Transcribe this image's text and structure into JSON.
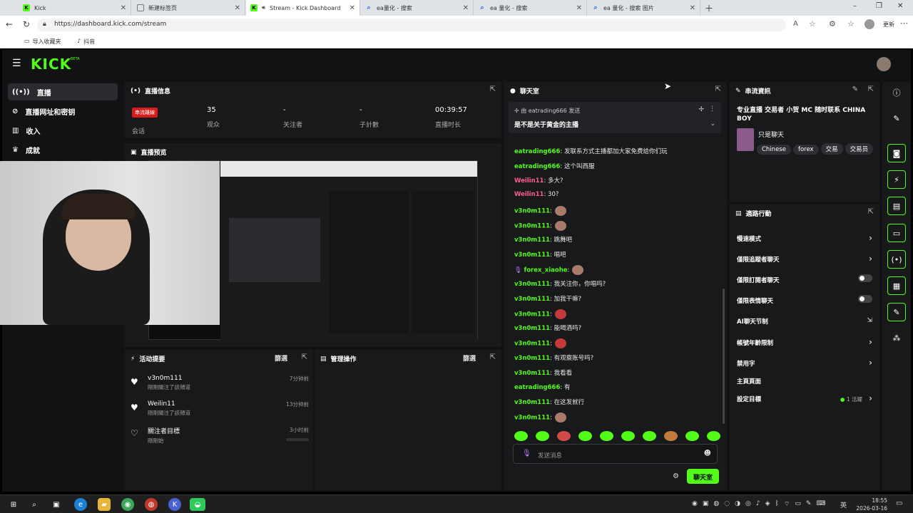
{
  "browser": {
    "tabs": [
      {
        "label": "Kick"
      },
      {
        "label": "新建标签页"
      },
      {
        "label": "Stream - Kick Dashboard"
      },
      {
        "label": "ea量化 - 搜索"
      },
      {
        "label": "ea 量化 - 搜索"
      },
      {
        "label": "ea 量化 - 搜索 图片"
      }
    ],
    "url": "https://dashboard.kick.com/stream",
    "bookmarks": [
      "导入收藏夹",
      "抖音"
    ],
    "profile_label": "更新"
  },
  "app": {
    "logo": "KICK",
    "logo_badge": "BETA"
  },
  "nav": {
    "items": [
      {
        "label": "直播"
      },
      {
        "label": "直播网址和密钥"
      },
      {
        "label": "收入"
      },
      {
        "label": "成就"
      }
    ]
  },
  "stream_info": {
    "title": "直播信息",
    "session_badge": "串流離線",
    "session_label": "会话",
    "viewers_value": "35",
    "viewers_label": "观众",
    "followers_value": "-",
    "followers_label": "关注者",
    "subs_value": "-",
    "subs_label": "子計數",
    "duration_value": "00:39:57",
    "duration_label": "直播时长"
  },
  "preview": {
    "title": "直播预览"
  },
  "activity": {
    "title": "活动提要",
    "filter": "篩選",
    "items": [
      {
        "user": "v3n0m111",
        "desc": "剛剛關注了該頻道",
        "time": "7分钟前"
      },
      {
        "user": "Weilin11",
        "desc": "剛剛關注了該頻道",
        "time": "13分钟前"
      },
      {
        "user": "關注者目標",
        "desc": "剛剛始",
        "time": "3小时前"
      }
    ]
  },
  "mod_actions": {
    "title": "管理操作",
    "filter": "篩選"
  },
  "chat": {
    "title": "聊天室",
    "pinned_by": "由 eatrading666 发送",
    "pinned_text": "是不是关于黄金的主播",
    "messages": [
      {
        "user": "eatrading666",
        "text": ": 发联系方式主播都加大家免费给你们玩"
      },
      {
        "user": "eatrading666",
        "text": ": 这个叫西服"
      },
      {
        "user": "Weilin11",
        "text": ": 多大?"
      },
      {
        "user": "Weilin11",
        "text": ": 30?"
      },
      {
        "user": "v3n0m111",
        "text": ":"
      },
      {
        "user": "v3n0m111",
        "text": ":"
      },
      {
        "user": "v3n0m111",
        "text": ": 跳舞吧"
      },
      {
        "user": "v3n0m111",
        "text": ": 唱吧"
      },
      {
        "user": "forex_xiaohe",
        "text": ":"
      },
      {
        "user": "v3n0m111",
        "text": ": 我关注你，你唱吗?"
      },
      {
        "user": "v3n0m111",
        "text": ": 加我干嘛?"
      },
      {
        "user": "v3n0m111",
        "text": ":"
      },
      {
        "user": "v3n0m111",
        "text": ": 能喝酒吗?"
      },
      {
        "user": "v3n0m111",
        "text": ":"
      },
      {
        "user": "v3n0m111",
        "text": ": 有观察账号吗?"
      },
      {
        "user": "v3n0m111",
        "text": ": 我看看"
      },
      {
        "user": "eatrading666",
        "text": ": 有"
      },
      {
        "user": "v3n0m111",
        "text": ": 在这发就行"
      },
      {
        "user": "v3n0m111",
        "text": ":"
      }
    ],
    "input_placeholder": "发送消息",
    "send_button": "聊天室"
  },
  "stream_info_panel": {
    "title": "串流資訊",
    "stream_title": "专业直播 交易者 小贺 MC 随时联系 CHINA BOY",
    "category": "只是聊天",
    "tags": [
      "Chinese",
      "forex",
      "交易",
      "交易员"
    ]
  },
  "mod_panel": {
    "title": "適路行動",
    "items": [
      {
        "label": "慢速模式"
      },
      {
        "label": "僅限追蹤者聊天"
      },
      {
        "label": "僅限訂閱者聊天"
      },
      {
        "label": "僅限表情聊天"
      },
      {
        "label": "AI聊天节制"
      },
      {
        "label": "帳號年齡限制"
      },
      {
        "label": "禁用字"
      },
      {
        "label": "主頁頁面"
      },
      {
        "label": "設定目標"
      }
    ],
    "goal_status": "1 活躍"
  },
  "taskbar": {
    "time": "18:55",
    "date": "2026-03-16",
    "lang": "英"
  }
}
